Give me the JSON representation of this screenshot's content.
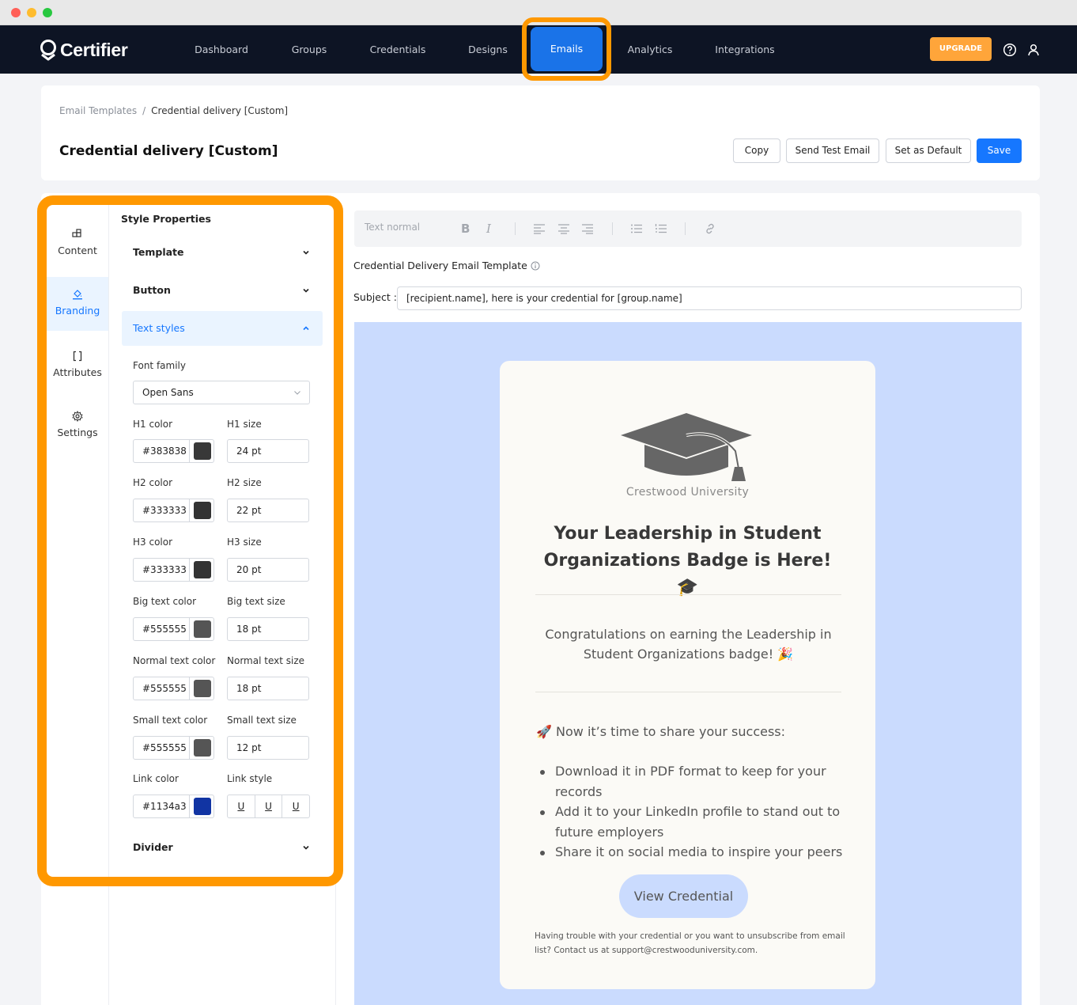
{
  "app": {
    "logo_text": "Certifier",
    "nav": [
      "Dashboard",
      "Groups",
      "Credentials",
      "Designs",
      "Emails",
      "Analytics",
      "Integrations"
    ],
    "upgrade_label": "UPGRADE",
    "icons": [
      "help-circle-icon",
      "user-icon"
    ]
  },
  "header": {
    "breadcrumb_root": "Email Templates",
    "breadcrumb_sep": "/",
    "breadcrumb_current": "Credential delivery [Custom]",
    "title": "Credential delivery [Custom]",
    "buttons": {
      "copy": "Copy",
      "send_test": "Send Test Email",
      "set_default": "Set as Default",
      "save": "Save"
    }
  },
  "sidebar": {
    "items": [
      {
        "label": "Content",
        "icon": "blocks-icon"
      },
      {
        "label": "Branding",
        "icon": "paint-bucket-icon"
      },
      {
        "label": "Attributes",
        "icon": "brackets-icon"
      },
      {
        "label": "Settings",
        "icon": "gear-icon"
      }
    ],
    "active": "Branding"
  },
  "style_properties": {
    "title": "Style Properties",
    "sections": {
      "template": "Template",
      "button": "Button",
      "text_styles": "Text styles",
      "divider": "Divider"
    },
    "font_family_label": "Font family",
    "font_family_value": "Open Sans",
    "rows": [
      {
        "color_label": "H1 color",
        "color_value": "#383838",
        "size_label": "H1 size",
        "size_value": "24 pt"
      },
      {
        "color_label": "H2 color",
        "color_value": "#333333",
        "size_label": "H2 size",
        "size_value": "22 pt"
      },
      {
        "color_label": "H3 color",
        "color_value": "#333333",
        "size_label": "H3 size",
        "size_value": "20 pt"
      },
      {
        "color_label": "Big text color",
        "color_value": "#555555",
        "size_label": "Big text size",
        "size_value": "18 pt"
      },
      {
        "color_label": "Normal text color",
        "color_value": "#555555",
        "size_label": "Normal text size",
        "size_value": "18 pt"
      },
      {
        "color_label": "Small text color",
        "color_value": "#555555",
        "size_label": "Small text size",
        "size_value": "12 pt"
      }
    ],
    "link_color_label": "Link color",
    "link_color_value": "#1134a3",
    "link_style_label": "Link style",
    "link_style_options": [
      "U",
      "U",
      "U"
    ]
  },
  "editor": {
    "toolbar_text_style": "Text normal",
    "toolbar_bold": "B",
    "toolbar_italic": "I",
    "template_label": "Credential Delivery Email Template",
    "subject_label": "Subject :",
    "subject_value": "[recipient.name], here is your credential for [group.name]"
  },
  "email": {
    "university": "Crestwood University",
    "heading": "Your Leadership in Student Organizations Badge is Here! 🎓",
    "congrats": "Congratulations on earning the Leadership in Student Organizations badge!  🎉",
    "share_intro": "🚀 Now it’s time to share your success:",
    "bullets": [
      "Download it in PDF format to keep for your records",
      "Add it to your LinkedIn profile to stand out to future employers",
      "Share it on social media to inspire your peers"
    ],
    "button_label": "View Credential",
    "footer": "Having trouble with your credential or you want to unsubscribe from email list? Contact us at  support@crestwooduniversity.com."
  },
  "colors": {
    "navbar": "#0d1424",
    "primary": "#1677ff",
    "highlight": "#ff9800",
    "upgrade": "#ffa53a",
    "email_background": "#cadbfe"
  }
}
